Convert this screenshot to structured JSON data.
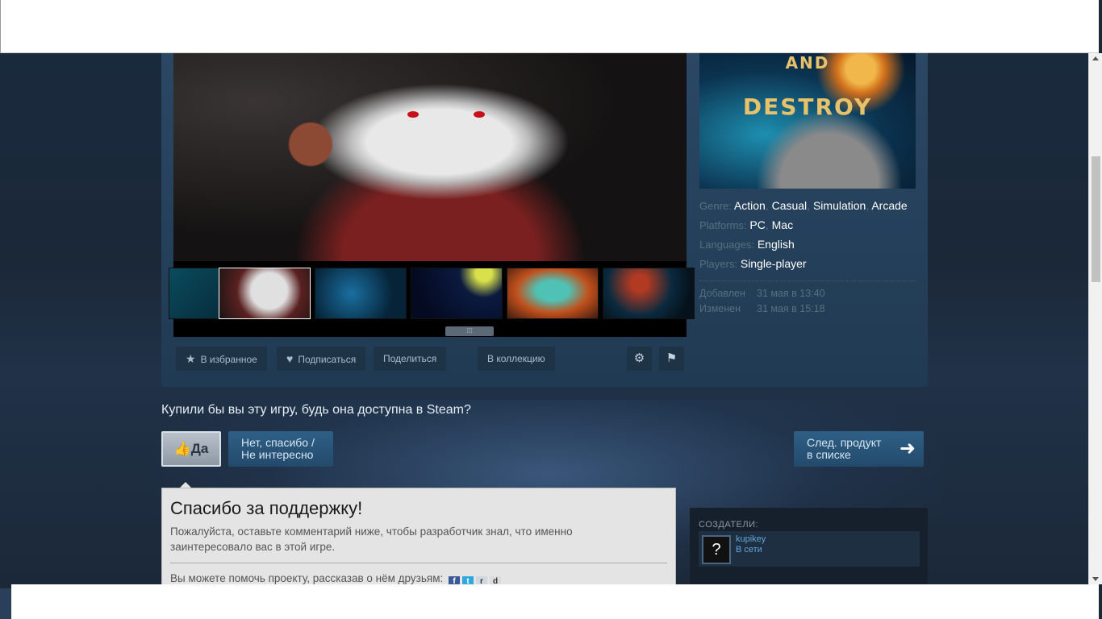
{
  "gallery": {
    "selected_index": 1
  },
  "capsule": {
    "title_line1": "AND",
    "title_line2": "DESTROY"
  },
  "details": {
    "genre_key": "Genre:",
    "genres": [
      "Action",
      "Casual",
      "Simulation",
      "Arcade"
    ],
    "platforms_key": "Platforms:",
    "platforms": [
      "PC",
      "Mac"
    ],
    "languages_key": "Languages:",
    "languages": "English",
    "players_key": "Players:",
    "players": "Single-player",
    "added_key": "Добавлен",
    "added_value": "31 мая в 13:40",
    "updated_key": "Изменен",
    "updated_value": "31 мая в 15:18"
  },
  "actions": {
    "favorite": "В избранное",
    "follow": "Подписаться",
    "share": "Поделиться",
    "collection": "В коллекцию"
  },
  "vote": {
    "question": "Купили бы вы эту игру, будь она доступна в Steam?",
    "yes": "Да",
    "no_line1": "Нет, спасибо /",
    "no_line2": "Не интересно",
    "next_line1": "След. продукт",
    "next_line2": "в списке"
  },
  "thanks": {
    "title": "Спасибо за поддержку!",
    "description": "Пожалуйста, оставьте комментарий ниже, чтобы разработчик знал, что именно заинтересовало вас в этой игре.",
    "share_text": "Вы можете помочь проекту, рассказав о нём друзьям:"
  },
  "creators": {
    "title": "СОЗДАТЕЛИ:",
    "name": "kupikey",
    "status": "В сети",
    "avatar": "?"
  },
  "colors": {
    "background": "#1b2838",
    "panel": "#2a4764",
    "link": "#62a7d8",
    "button_blue": "#2f5f86"
  }
}
